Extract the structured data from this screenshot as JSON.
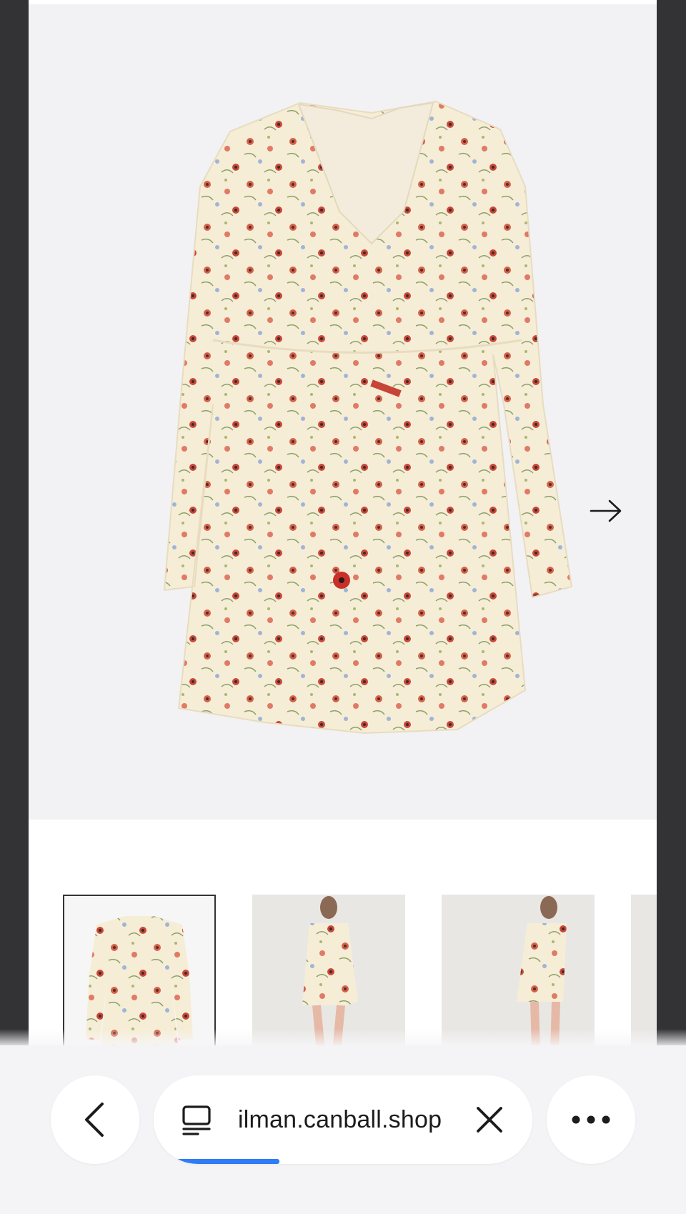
{
  "product_gallery": {
    "image_alt": "Floral print long-sleeve playsuit",
    "next_icon": "arrow-right-icon",
    "thumbnails": [
      {
        "name": "front view",
        "selected": true
      },
      {
        "name": "model front view",
        "selected": false
      },
      {
        "name": "model back view",
        "selected": false
      },
      {
        "name": "partial view",
        "selected": false
      }
    ]
  },
  "browser": {
    "back_icon": "chevron-left-icon",
    "tabs_icon": "tabs-icon",
    "url": "ilman.canball.shop",
    "stop_icon": "close-icon",
    "more_icon": "ellipsis-icon",
    "load_progress": 0.31,
    "accent_color": "#2f7cf6"
  }
}
